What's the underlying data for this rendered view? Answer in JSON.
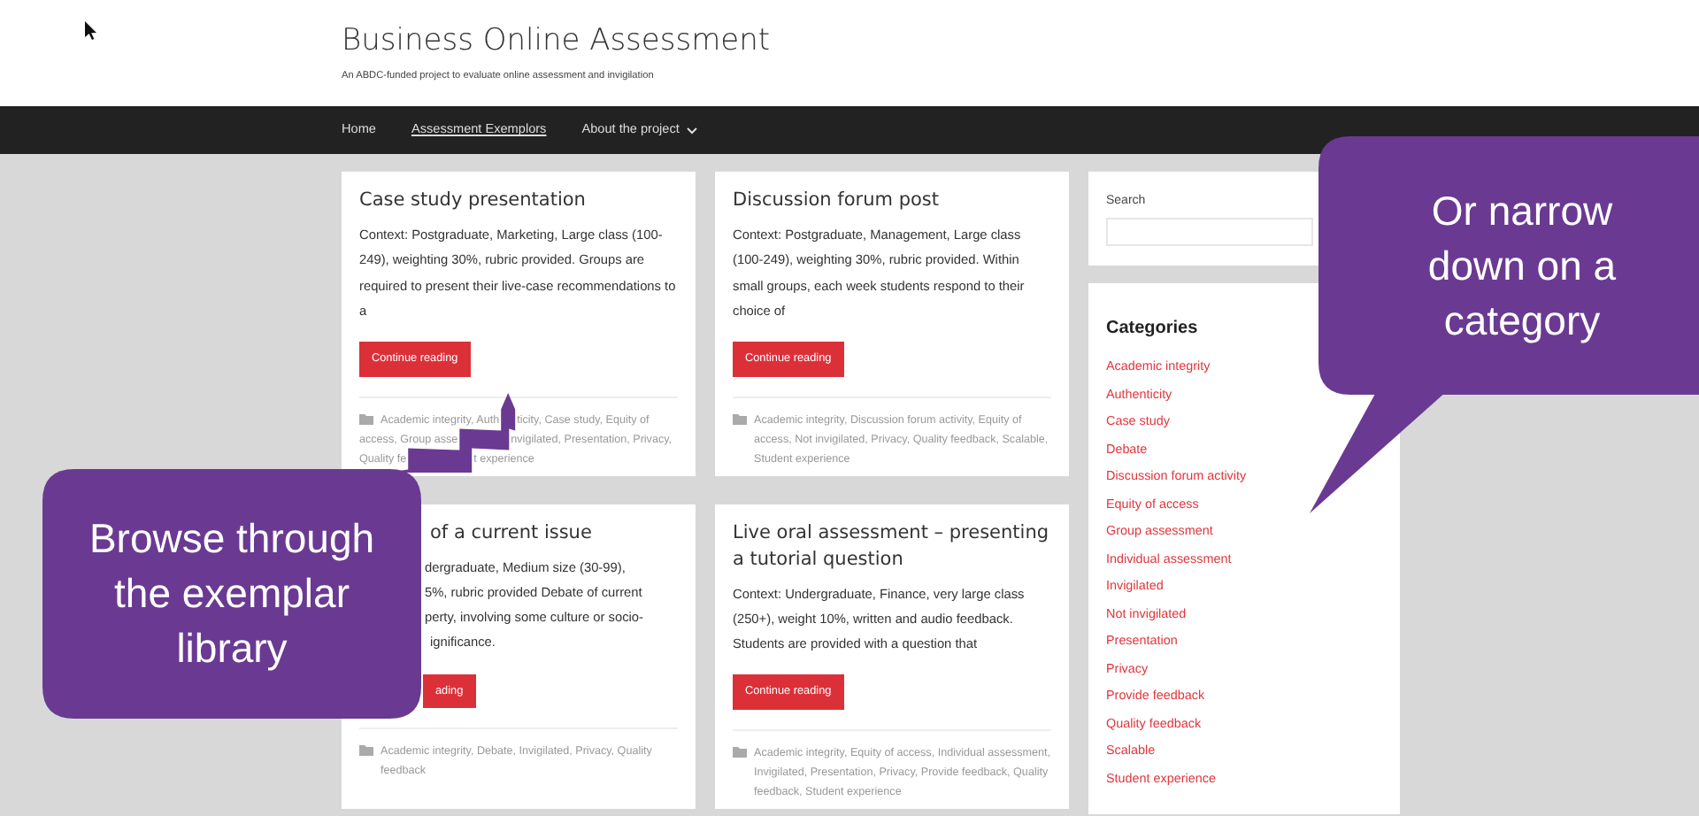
{
  "header": {
    "title": "Business Online Assessment",
    "tagline": "An ABDC-funded project to evaluate online assessment and invigilation"
  },
  "nav": [
    {
      "label": "Home",
      "selected": false,
      "has_dropdown": false
    },
    {
      "label": "Assessment Exemplors",
      "selected": true,
      "has_dropdown": false
    },
    {
      "label": "About the project",
      "selected": false,
      "has_dropdown": true
    }
  ],
  "posts": [
    {
      "kind": "tags_covered",
      "title": "Case study presentation",
      "excerpt": "Context: Postgraduate, Marketing, Large class (100-249), weighting 30%, rubric provided. Groups are required to present their live-case recommendations to a",
      "button": "Continue reading",
      "tag_lines": [
        [
          "Academic integrity, Auth",
          "ticity, Case study, Equity of"
        ],
        [
          "access, Group asse",
          "nvigilated, Presentation, Privacy,"
        ],
        [
          "Quality fe",
          "t experience"
        ]
      ]
    },
    {
      "kind": "full",
      "title": "Discussion forum post",
      "excerpt": "Context: Postgraduate, Management, Large class (100-249), weighting 30%, rubric provided. Within small groups, each week students respond to their choice of",
      "button": "Continue reading",
      "tags": "Academic integrity, Discussion forum activity, Equity of access, Not invigilated, Privacy, Quality feedback, Scalable, Student experience"
    },
    {
      "kind": "left_covered",
      "title": "of a current issue",
      "excerpt_lines": [
        "dergraduate, Medium size (30-99),",
        "5%, rubric provided Debate of current",
        "perty, involving some culture or socio-",
        "ignificance."
      ],
      "button": "ading",
      "tags": "Academic integrity, Debate, Invigilated, Privacy, Quality feedback"
    },
    {
      "kind": "full",
      "title": "Live oral assessment – presenting a tutorial question",
      "excerpt": "Context: Undergraduate, Finance, very large class (250+), weight 10%, written and audio feedback. Students are provided with a question that",
      "button": "Continue reading",
      "tags": "Academic integrity, Equity of access, Individual assessment, Invigilated, Presentation, Privacy, Provide feedback, Quality feedback, Student experience"
    }
  ],
  "sidebar": {
    "search_label": "Search",
    "categories_title": "Categories",
    "categories": [
      "Academic integrity",
      "Authenticity",
      "Case study",
      "Debate",
      "Discussion forum activity",
      "Equity of access",
      "Group assessment",
      "Individual assessment",
      "Invigilated",
      "Not invigilated",
      "Presentation",
      "Privacy",
      "Provide feedback",
      "Quality feedback",
      "Scalable",
      "Student experience"
    ]
  },
  "callouts": [
    {
      "kind": "left",
      "text": "Browse through the exemplar library"
    },
    {
      "kind": "right",
      "text": "Or narrow down on a category"
    }
  ]
}
